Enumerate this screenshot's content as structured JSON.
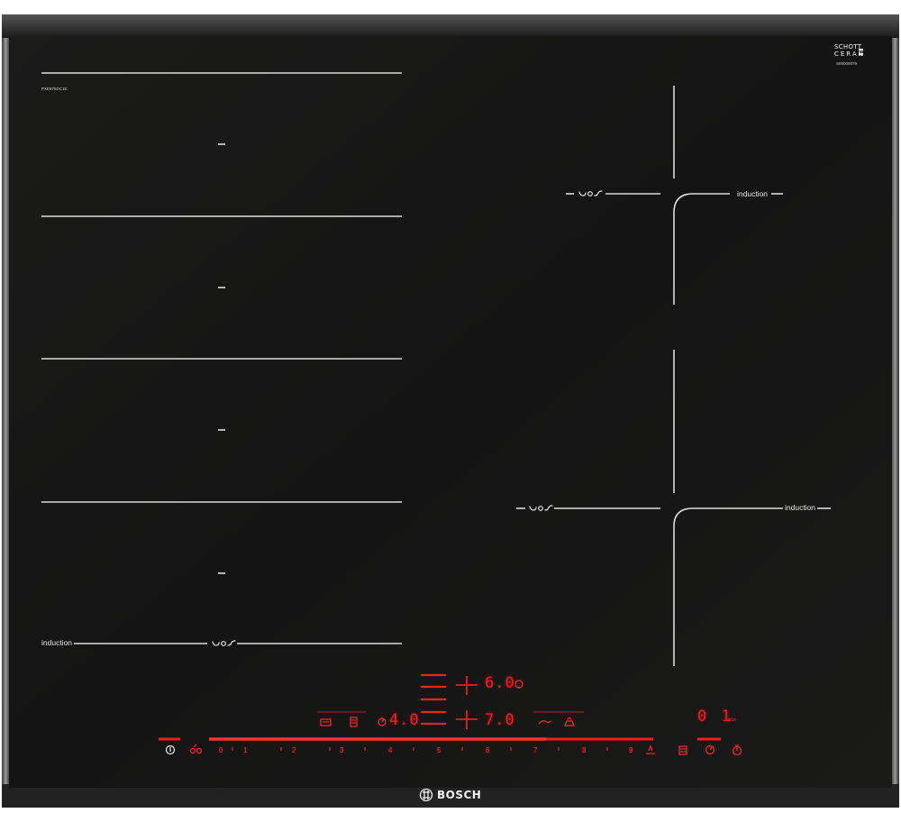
{
  "product": {
    "model_code": "PXE875DC1E",
    "glass_brand_line1": "SCHOTT",
    "glass_brand_line2": "CERAN",
    "serial_small": "S00000079",
    "brand": "BOSCH"
  },
  "zones": {
    "induction_label": "induction",
    "left_label": "induction",
    "right_top_label": "induction",
    "right_bottom_label": "induction"
  },
  "display": {
    "zone_top_power": "6.0",
    "zone_mid_power": "7.0",
    "zone_left_power": "4.0",
    "timer_value": "0 1",
    "timer_unit": "min"
  },
  "slider": {
    "levels": [
      "0",
      "1",
      "2",
      "3",
      "4",
      "5",
      "6",
      "7",
      "8",
      "9"
    ]
  },
  "colors": {
    "glass": "#151515",
    "frame": "#6f6f6f",
    "marking": "#dcdcdc",
    "display_red": "#ff1a1a"
  }
}
